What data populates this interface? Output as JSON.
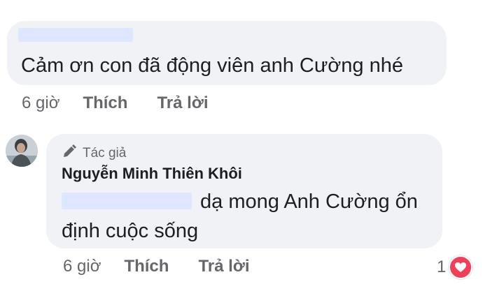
{
  "comments": [
    {
      "text": "Cảm ơn con đã động viên anh Cường nhé",
      "time": "6 giờ",
      "like_label": "Thích",
      "reply_label": "Trả lời"
    },
    {
      "badge": "Tác giả",
      "author": "Nguyễn Minh Thiên Khôi",
      "text_line1": "dạ mong Anh Cường ổn",
      "text_line2": "định cuộc sống",
      "time": "6 giờ",
      "like_label": "Thích",
      "reply_label": "Trả lời",
      "reaction_count": "1",
      "reaction_icon": "heart-icon"
    }
  ],
  "colors": {
    "bubble": "#f0f2f5",
    "meta_text": "#65676b",
    "redaction": "#dfe6ff",
    "heart": "#f33e58"
  }
}
